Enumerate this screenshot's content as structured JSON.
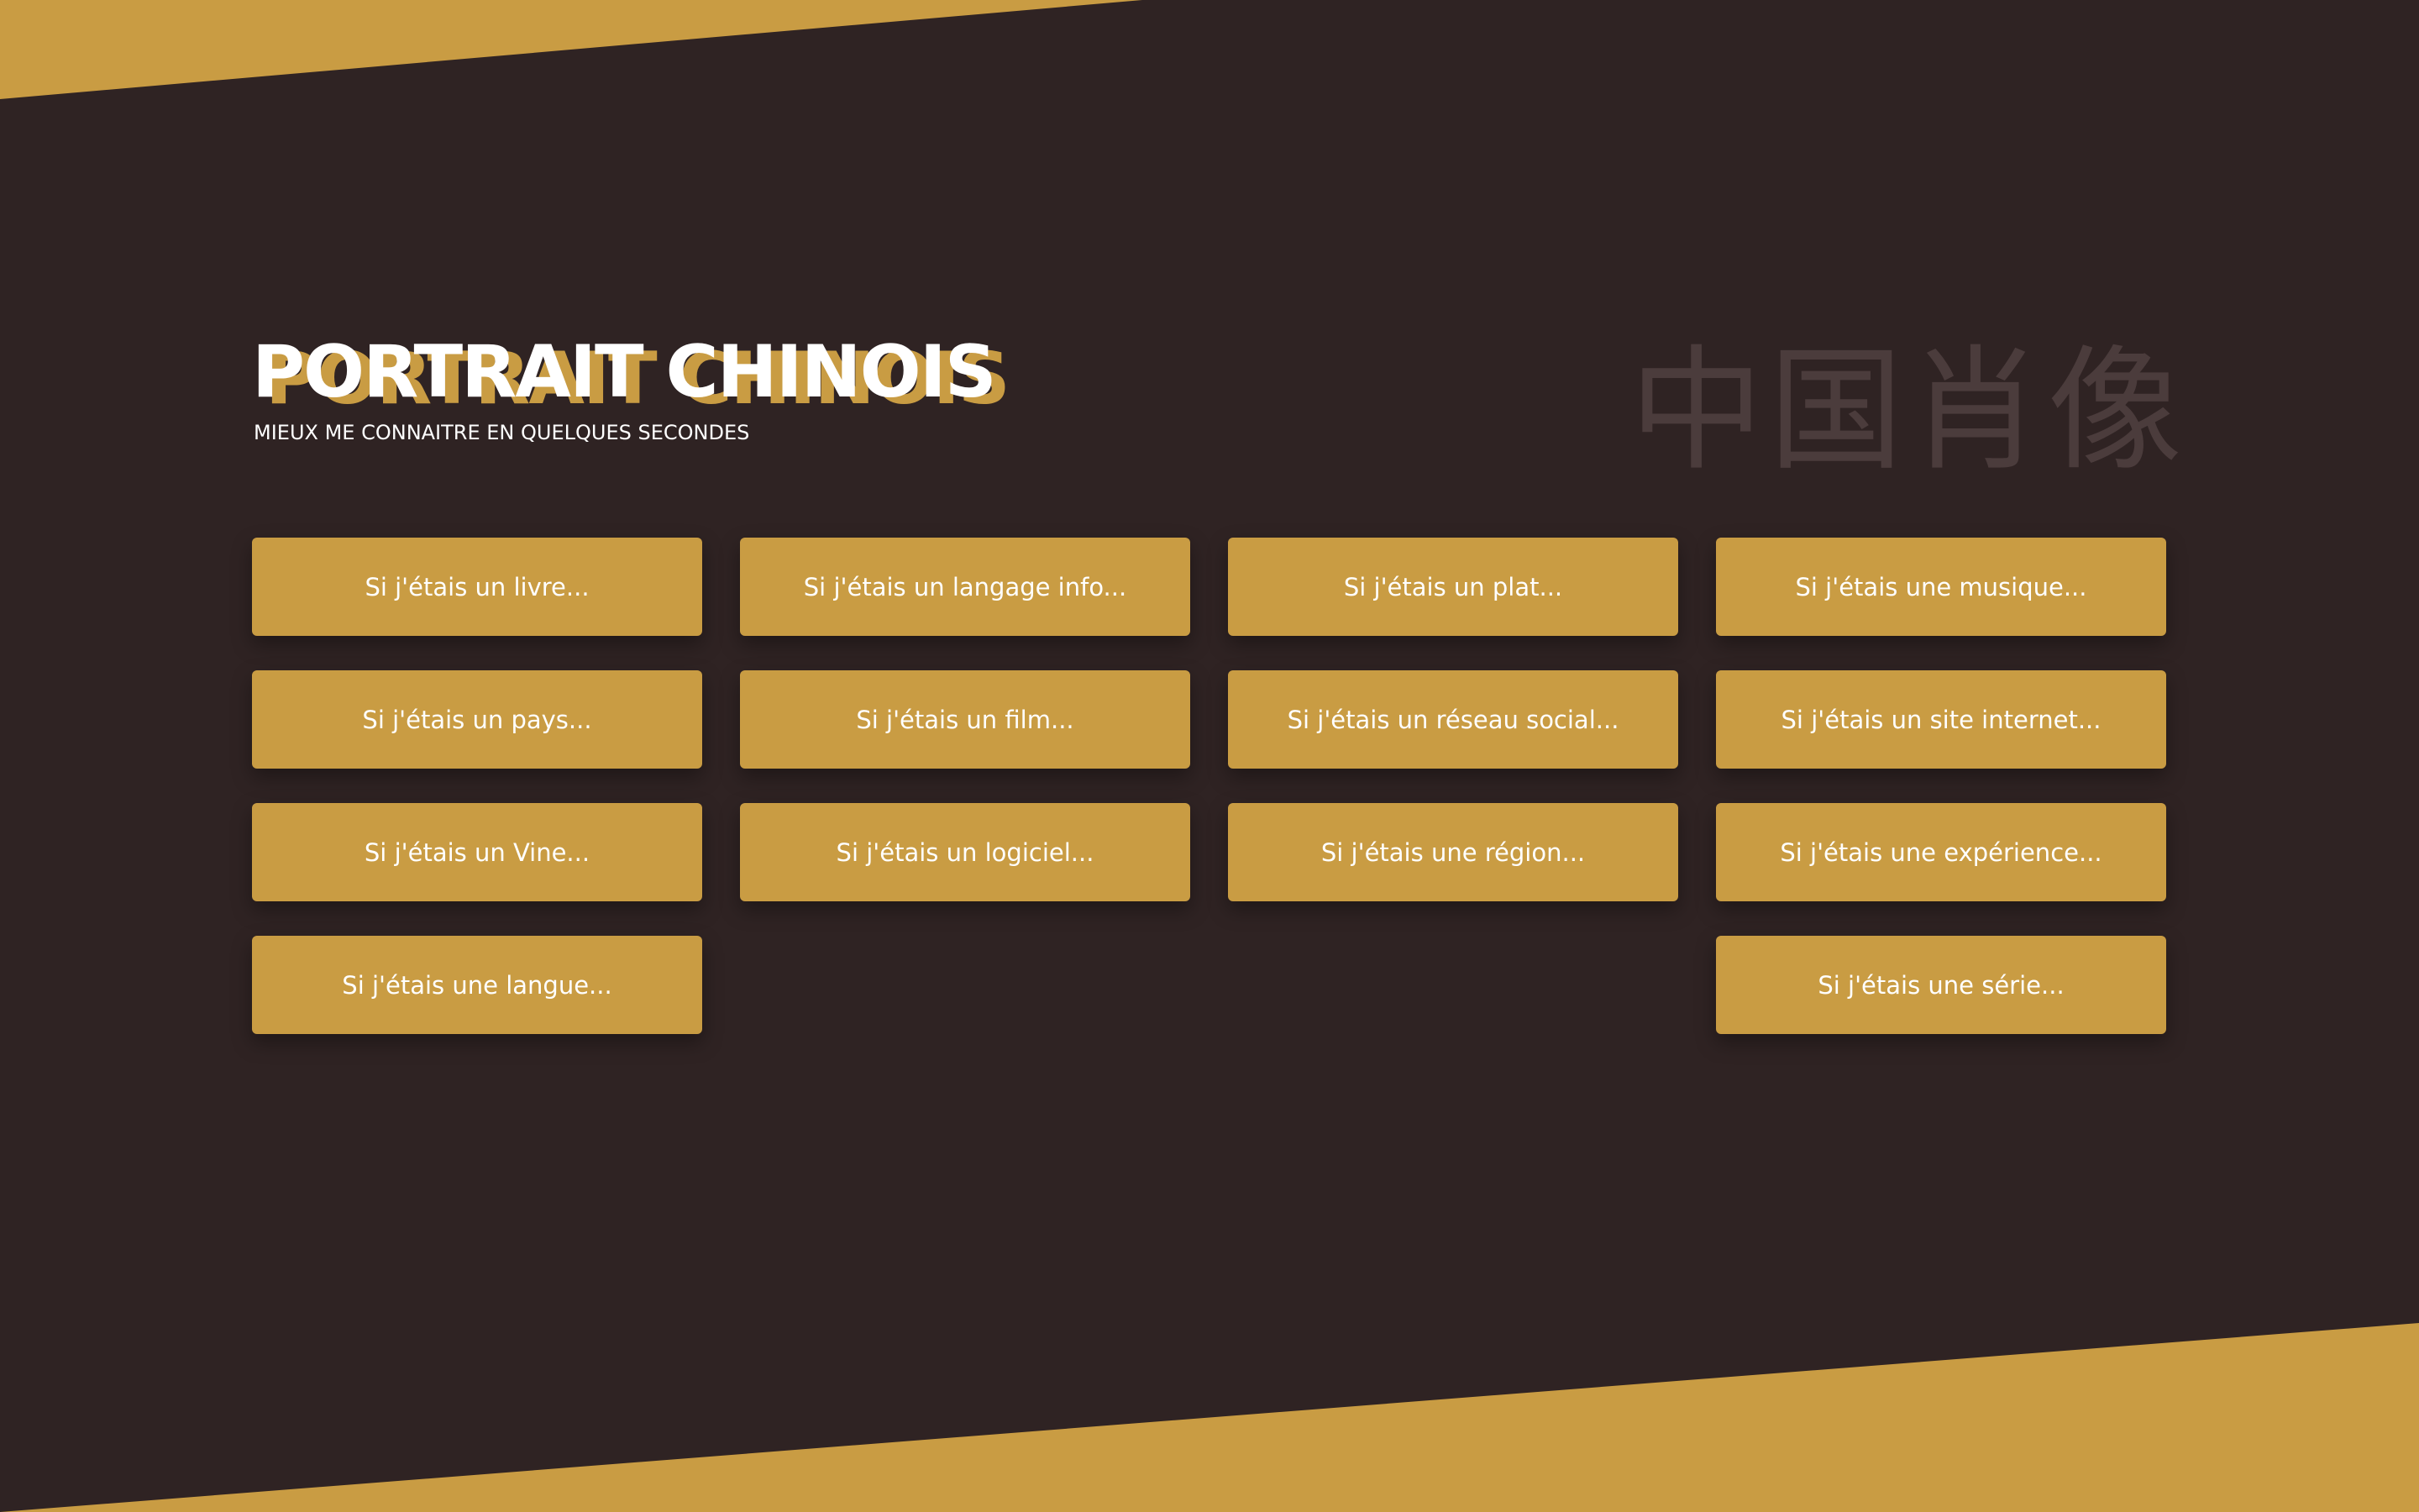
{
  "header": {
    "title": "PORTRAIT CHINOIS",
    "subtitle": "MIEUX ME CONNAITRE EN QUELQUES SECONDES",
    "chinese_title": "中国肖像"
  },
  "buttons": {
    "livre": "Si j'étais un livre...",
    "langage": "Si j'étais un langage info...",
    "plat": "Si j'étais un plat...",
    "musique": "Si j'étais une musique...",
    "pays": "Si j'étais un pays...",
    "film": "Si j'étais un film...",
    "reseau": "Si j'étais un réseau social...",
    "site": "Si j'étais un site internet...",
    "vine": "Si j'étais un Vine...",
    "logiciel": "Si j'étais un logiciel...",
    "region": "Si j'étais une région...",
    "experience": "Si j'étais une expérience...",
    "langue": "Si j'étais une langue...",
    "serie": "Si j'étais une série..."
  },
  "colors": {
    "background": "#2f2323",
    "accent": "#c99c43",
    "text": "#ffffff",
    "chinese_watermark": "#4b3c3c"
  }
}
